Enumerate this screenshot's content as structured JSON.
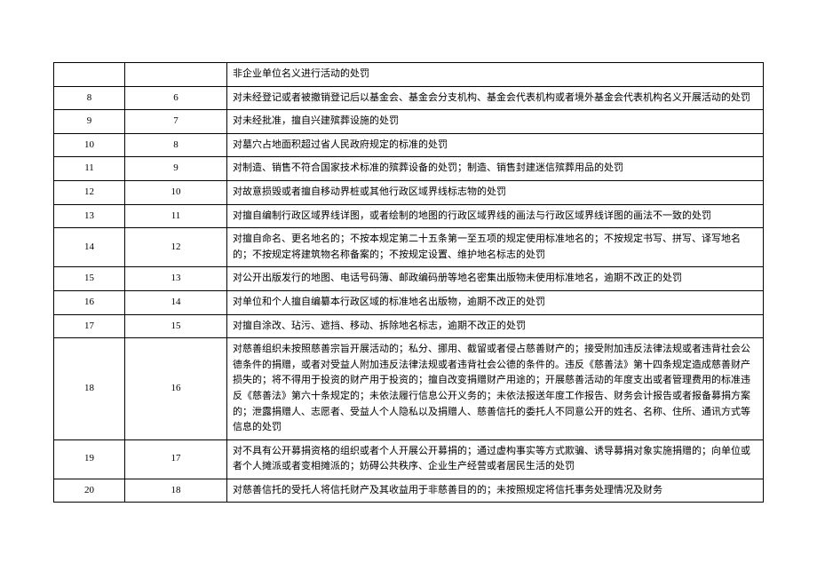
{
  "rows": [
    {
      "a": "",
      "b": "",
      "c": "非企业单位名义进行活动的处罚"
    },
    {
      "a": "8",
      "b": "6",
      "c": "对未经登记或者被撤销登记后以基金会、基金会分支机构、基金会代表机构或者境外基金会代表机构名义开展活动的处罚"
    },
    {
      "a": "9",
      "b": "7",
      "c": "对未经批准，擅自兴建殡葬设施的处罚"
    },
    {
      "a": "10",
      "b": "8",
      "c": "对墓穴占地面积超过省人民政府规定的标准的处罚"
    },
    {
      "a": "11",
      "b": "9",
      "c": "对制造、销售不符合国家技术标准的殡葬设备的处罚；制造、销售封建迷信殡葬用品的处罚"
    },
    {
      "a": "12",
      "b": "10",
      "c": "对故意损毁或者擅自移动界桩或其他行政区域界线标志物的处罚"
    },
    {
      "a": "13",
      "b": "11",
      "c": "对擅自编制行政区域界线详图，或者绘制的地图的行政区域界线的画法与行政区域界线详图的画法不一致的处罚"
    },
    {
      "a": "14",
      "b": "12",
      "c": "对擅自命名、更名地名的；不按本规定第二十五条第一至五项的规定使用标准地名的；不按规定书写、拼写、译写地名的；不按规定将建筑物名称备案的；不按规定设置、维护地名标志的处罚"
    },
    {
      "a": "15",
      "b": "13",
      "c": "对公开出版发行的地图、电话号码簿、邮政编码册等地名密集出版物未使用标准地名，逾期不改正的处罚"
    },
    {
      "a": "16",
      "b": "14",
      "c": "对单位和个人擅自编纂本行政区域的标准地名出版物，逾期不改正的处罚"
    },
    {
      "a": "17",
      "b": "15",
      "c": "对擅自涂改、玷污、遮挡、移动、拆除地名标志，逾期不改正的处罚"
    },
    {
      "a": "18",
      "b": "16",
      "c": "对慈善组织未按照慈善宗旨开展活动的；私分、挪用、截留或者侵占慈善财产的；接受附加违反法律法规或者违背社会公德条件的捐赠，或者对受益人附加违反法律法规或者违背社会公德的条件的。违反《慈善法》第十四条规定造成慈善财产损失的；将不得用于投资的财产用于投资的；擅自改变捐赠财产用途的；开展慈善活动的年度支出或者管理费用的标准违反《慈善法》第六十条规定的；未依法履行信息公开义务的；未依法报送年度工作报告、财务会计报告或者报备募捐方案的；泄露捐赠人、志愿者、受益人个人隐私以及捐赠人、慈善信托的委托人不同意公开的姓名、名称、住所、通讯方式等信息的处罚"
    },
    {
      "a": "19",
      "b": "17",
      "c": "对不具有公开募捐资格的组织或者个人开展公开募捐的；通过虚构事实等方式欺骗、诱导募捐对象实施捐赠的；向单位或者个人摊派或者变相摊派的；妨碍公共秩序、企业生产经营或者居民生活的处罚"
    },
    {
      "a": "20",
      "b": "18",
      "c": "对慈善信托的受托人将信托财产及其收益用于非慈善目的的；未按照规定将信托事务处理情况及财务"
    }
  ]
}
